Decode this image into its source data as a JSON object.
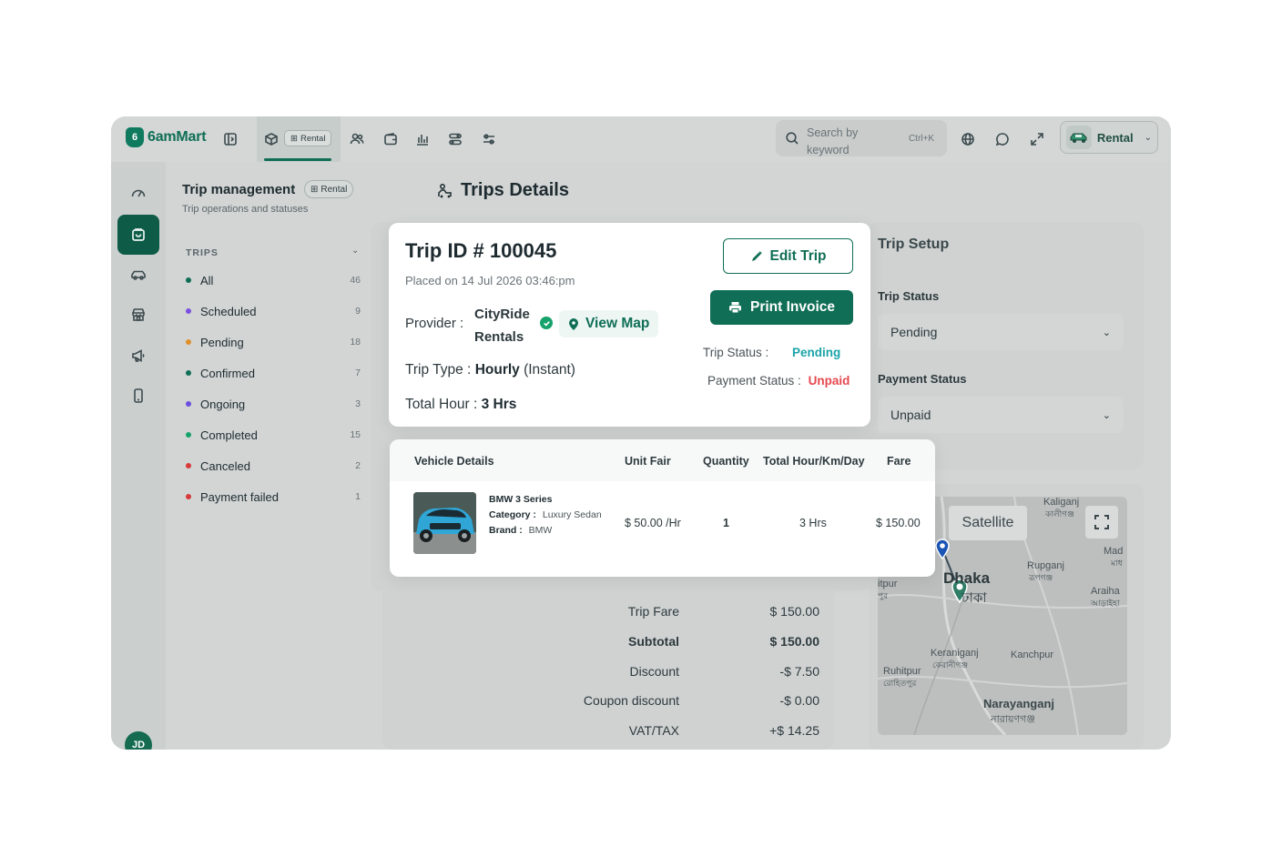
{
  "app": {
    "brand": "6amMart",
    "module_chip": "Rental",
    "search_placeholder": "Search by keyword",
    "search_shortcut": "Ctrl+K",
    "module_switch_label": "Rental",
    "avatar_initials": "JD",
    "accent": "#0f6e55"
  },
  "sidebar": {
    "title": "Trip management",
    "chip": "Rental",
    "subtitle": "Trip operations and statuses",
    "section": "TRIPS",
    "items": [
      {
        "label": "All",
        "count": "46",
        "color": "#0f6e55"
      },
      {
        "label": "Scheduled",
        "count": "9",
        "color": "#7b4fe0"
      },
      {
        "label": "Pending",
        "count": "18",
        "color": "#e0902a"
      },
      {
        "label": "Confirmed",
        "count": "7",
        "color": "#0f6e55"
      },
      {
        "label": "Ongoing",
        "count": "3",
        "color": "#6a4fe0"
      },
      {
        "label": "Completed",
        "count": "15",
        "color": "#16a36b"
      },
      {
        "label": "Canceled",
        "count": "2",
        "color": "#d63a3a"
      },
      {
        "label": "Payment failed",
        "count": "1",
        "color": "#d63a3a"
      }
    ]
  },
  "main": {
    "title": "Trips Details"
  },
  "trip": {
    "id_label": "Trip ID # 100045",
    "placed": "Placed on 14 Jul 2026 03:46:pm",
    "provider_label": "Provider :",
    "provider_name": "CityRide Rentals",
    "view_map": "View Map",
    "trip_type_label": "Trip Type :",
    "trip_type_value": "Hourly",
    "trip_type_note": "(Instant)",
    "total_hour_label": "Total Hour :",
    "total_hour_value": "3 Hrs",
    "edit_button": "Edit Trip",
    "print_button": "Print Invoice",
    "trip_status_label": "Trip Status :",
    "trip_status_value": "Pending",
    "payment_status_label": "Payment Status :",
    "payment_status_value": "Unpaid"
  },
  "setup": {
    "title": "Trip Setup",
    "trip_status_label": "Trip Status",
    "trip_status_value": "Pending",
    "payment_status_label": "Payment Status",
    "payment_status_value": "Unpaid"
  },
  "vehicle_table": {
    "headers": [
      "Vehicle Details",
      "Unit Fair",
      "Quantity",
      "Total Hour/Km/Day",
      "Fare"
    ],
    "row": {
      "name": "BMW 3 Series",
      "category_label": "Category :",
      "category": "Luxury Sedan",
      "brand_label": "Brand :",
      "brand": "BMW",
      "unit_fair": "$ 50.00 /Hr",
      "quantity": "1",
      "total": "3 Hrs",
      "fare": "$ 150.00"
    }
  },
  "fare_summary": [
    {
      "label": "Trip Fare",
      "value": "$ 150.00",
      "bold": false
    },
    {
      "label": "Subtotal",
      "value": "$ 150.00",
      "bold": true
    },
    {
      "label": "Discount",
      "value": "-$ 7.50",
      "bold": false
    },
    {
      "label": "Coupon discount",
      "value": "-$ 0.00",
      "bold": false
    },
    {
      "label": "VAT/TAX",
      "value": "+$ 14.25",
      "bold": false
    }
  ],
  "map": {
    "satellite_button": "Satellite",
    "places": [
      "Kaliganj",
      "কালীগঞ্জ",
      "Rupganj",
      "রূপগঞ্জ",
      "Dhaka",
      "ঢাকা",
      "Mad",
      "মাধ",
      "Araiha",
      "আড়াইহা",
      "Keraniganj",
      "কেরানীগঞ্জ",
      "Kanchpur",
      "Ruhitpur",
      "রোহিতপুর",
      "Narayanganj",
      "নারায়ণগঞ্জ",
      "itpur",
      "পুর"
    ]
  }
}
